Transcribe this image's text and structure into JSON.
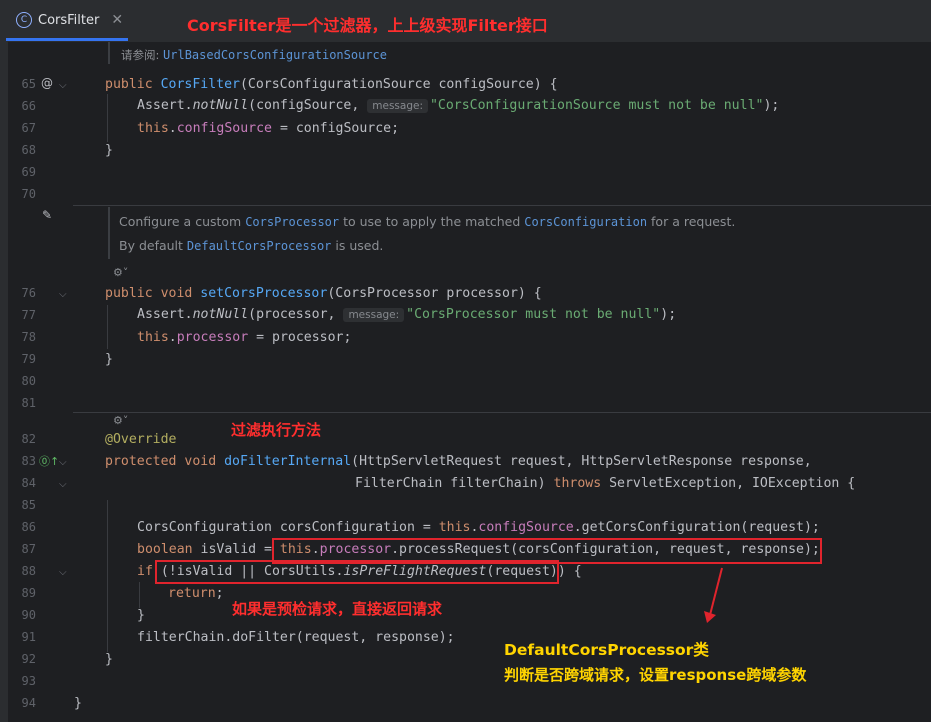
{
  "tab": {
    "label": "CorsFilter",
    "icon": "class-c-icon",
    "close": "✕"
  },
  "annotations": {
    "title": "CorsFilter是一个过滤器，上上级实现Filter接口",
    "filter_method": "过滤执行方法",
    "preflight": "如果是预检请求，直接返回请求",
    "processor_title": "DefaultCorsProcessor类",
    "processor_desc": "判断是否跨域请求，设置response跨域参数"
  },
  "doc1": {
    "prefix": "请参阅: ",
    "link": "UrlBasedCorsConfigurationSource"
  },
  "doc2": {
    "l1a": "Configure a custom ",
    "l1b": "CorsProcessor",
    "l1c": " to use to apply the matched ",
    "l1d": "CorsConfiguration",
    "l1e": " for a request.",
    "l2a": "By default ",
    "l2b": "DefaultCorsProcessor",
    "l2c": " is used."
  },
  "lines": [
    "65",
    "66",
    "67",
    "68",
    "69",
    "70",
    "76",
    "77",
    "78",
    "79",
    "80",
    "81",
    "82",
    "83",
    "84",
    "85",
    "86",
    "87",
    "88",
    "89",
    "90",
    "91",
    "92",
    "93",
    "94"
  ],
  "code": {
    "l65": {
      "kw": "public ",
      "fn": "CorsFilter",
      "rest": "(CorsConfigurationSource configSource) {"
    },
    "l66": {
      "a": "Assert.",
      "m": "notNull",
      "b": "(configSource, ",
      "hint": "message:",
      "str": "\"CorsConfigurationSource must not be null\"",
      "end": ");"
    },
    "l67": {
      "kw": "this",
      "dot": ".",
      "fld": "configSource",
      "rest": " = configSource;"
    },
    "l68": "}",
    "l76": {
      "kw": "public void ",
      "fn": "setCorsProcessor",
      "rest": "(CorsProcessor processor) {"
    },
    "l77": {
      "a": "Assert.",
      "m": "notNull",
      "b": "(processor, ",
      "hint": "message:",
      "str": "\"CorsProcessor must not be null\"",
      "end": ");"
    },
    "l78": {
      "kw": "this",
      "dot": ".",
      "fld": "processor",
      "rest": " = processor;"
    },
    "l79": "}",
    "l82": "@Override",
    "l83": {
      "kw": "protected void ",
      "fn": "doFilterInternal",
      "rest": "(HttpServletRequest request, HttpServletResponse response,"
    },
    "l84": {
      "a": "FilterChain filterChain) ",
      "kw": "throws",
      "b": " ServletException, IOException {"
    },
    "l86": {
      "a": "CorsConfiguration corsConfiguration = ",
      "kw": "this",
      "dot": ".",
      "fld": "configSource",
      "b": ".getCorsConfiguration(request);"
    },
    "l87": {
      "kw": "boolean",
      "a": " isValid = ",
      "kw2": "this",
      "dot": ".",
      "fld": "processor",
      "b": ".processRequest(corsConfiguration, request, response);"
    },
    "l88": {
      "kw": "if",
      "a": " (!isValid || CorsUtils.",
      "m": "isPreFlightRequest",
      "b": "(request)) {"
    },
    "l89": {
      "kw": "return",
      "a": ";"
    },
    "l90": "}",
    "l91": "filterChain.doFilter(request, response);",
    "l92": "}",
    "l94": "}"
  }
}
